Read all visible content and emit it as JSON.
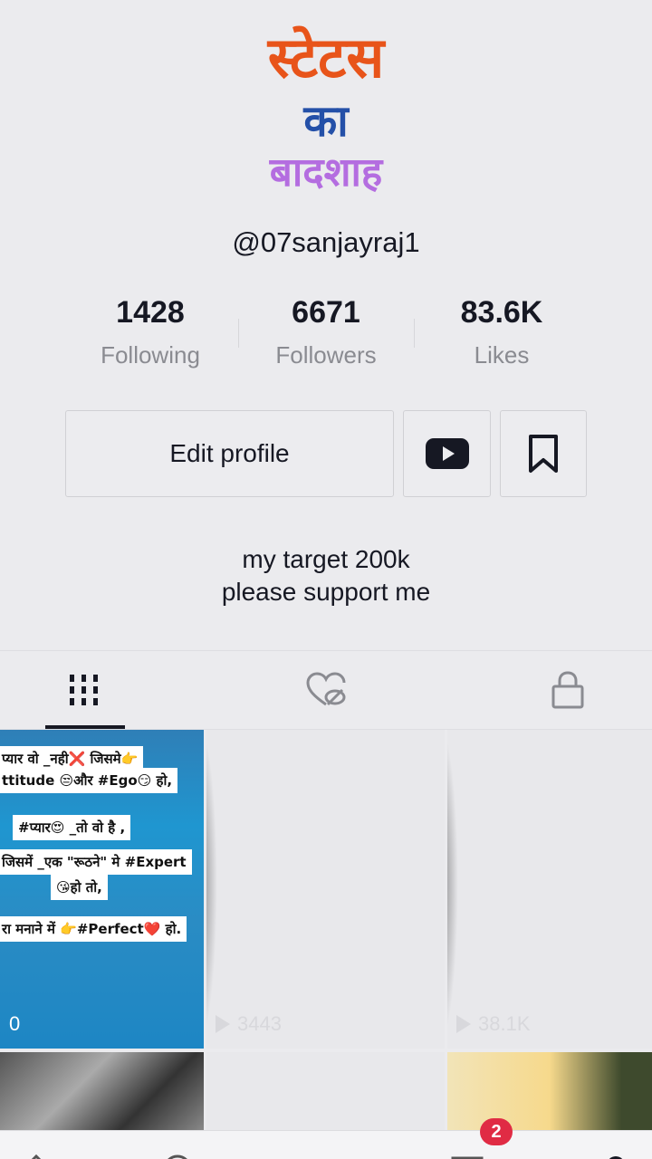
{
  "profile_logo": {
    "line1": "स्टेटस",
    "line2": "का",
    "line3": "बादशाह",
    "colors": {
      "line1": "#e8541a",
      "line2": "#2450a8",
      "line3": "#b46de0"
    }
  },
  "username": "@07sanjayraj1",
  "stats": {
    "following": {
      "value": "1428",
      "label": "Following"
    },
    "followers": {
      "value": "6671",
      "label": "Followers"
    },
    "likes": {
      "value": "83.6K",
      "label": "Likes"
    }
  },
  "actions": {
    "edit_profile": "Edit profile",
    "youtube_icon": "youtube-icon",
    "bookmark_icon": "bookmark-icon"
  },
  "bio": {
    "line1": "my target 200k",
    "line2": "please support me"
  },
  "tabs": [
    {
      "name": "videos",
      "icon": "grid-icon",
      "active": true
    },
    {
      "name": "liked",
      "icon": "heart-hidden-icon",
      "active": false
    },
    {
      "name": "private",
      "icon": "lock-icon",
      "active": false
    }
  ],
  "videos": [
    {
      "caption_lines": [
        "प्यार वो _नही❌ जिसमे👉",
        "ttitude 😒और #Ego😏 हो,",
        "#प्यार😍 _तो वो है ,",
        "जिसमें _एक \"रूठने\" मे #Expert",
        "😘हो तो,",
        "रा मनाने में 👉#Perfect❤️ हो."
      ],
      "views": "0"
    },
    {
      "views": "3443"
    },
    {
      "views": "38.1K"
    }
  ],
  "bottom_nav": {
    "inbox_badge": "2"
  },
  "colors": {
    "background": "#ebebee",
    "text": "#161823",
    "muted": "#8a8b91",
    "badge": "#e02b44"
  }
}
